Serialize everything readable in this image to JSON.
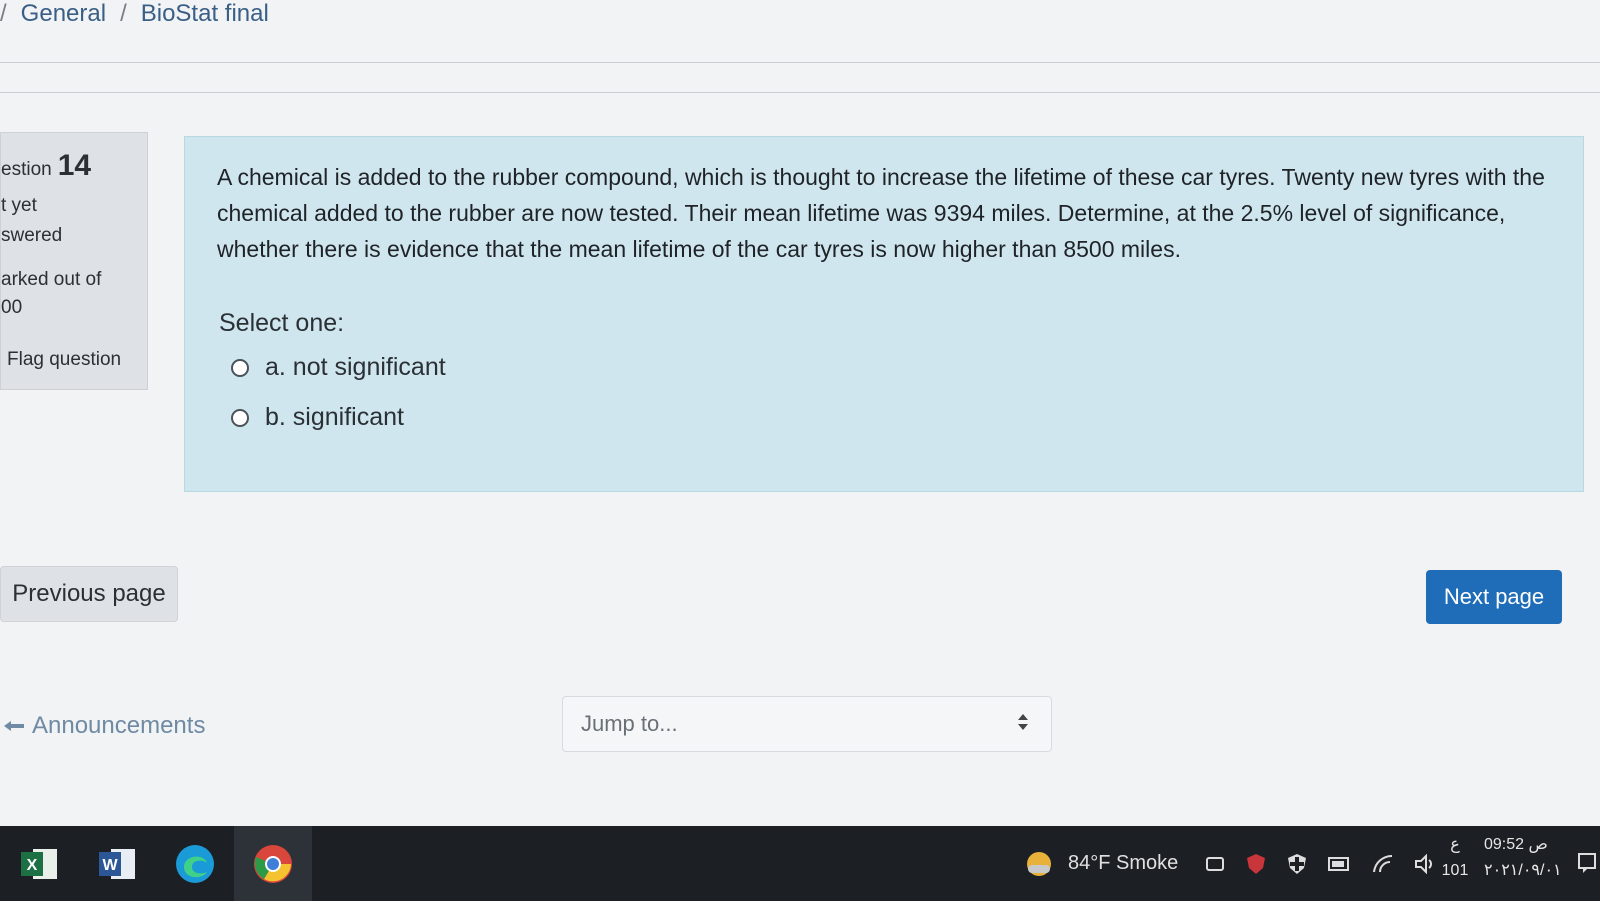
{
  "breadcrumb": {
    "items": [
      "General",
      "BioStat final"
    ],
    "separator": "/"
  },
  "question_info": {
    "label": "estion",
    "number": "14",
    "state_line1": "t yet",
    "state_line2": "swered",
    "marked_line1": "arked out of",
    "marked_line2": "00",
    "flag_label": "Flag question"
  },
  "question": {
    "text": "A chemical is added to the rubber compound, which is thought to increase the lifetime of these car tyres. Twenty new tyres with the chemical added to the rubber are now tested. Their mean lifetime was 9394 miles. Determine, at the 2.5% level of significance, whether there is evidence that the mean lifetime of the car tyres is now higher than 8500 miles.",
    "select_label": "Select one:",
    "options": [
      {
        "label": "a. not significant",
        "selected": false
      },
      {
        "label": "b. significant",
        "selected": false
      }
    ]
  },
  "navigation": {
    "previous_label": "Previous page",
    "next_label": "Next page",
    "announcements_label": "Announcements",
    "jump_placeholder": "Jump to..."
  },
  "taskbar": {
    "apps": [
      {
        "name": "excel-icon",
        "letter": "X",
        "color": "#1d7044"
      },
      {
        "name": "word-icon",
        "letter": "W",
        "color": "#2b5797"
      },
      {
        "name": "edge-icon",
        "letter": "",
        "color": "#1a9bd7"
      },
      {
        "name": "chrome-icon",
        "letter": "",
        "color": "#d9463b"
      }
    ],
    "weather": "84°F  Smoke",
    "ime_line1": "ع",
    "ime_line2": "101",
    "time": "09:52 ص",
    "date": "٢٠٢١/٠٩/٠١"
  },
  "colors": {
    "accent": "#1f6cb8",
    "question_bg": "#cfe6ee",
    "info_bg": "#dee2e6",
    "taskbar_bg": "#1c1f24"
  }
}
